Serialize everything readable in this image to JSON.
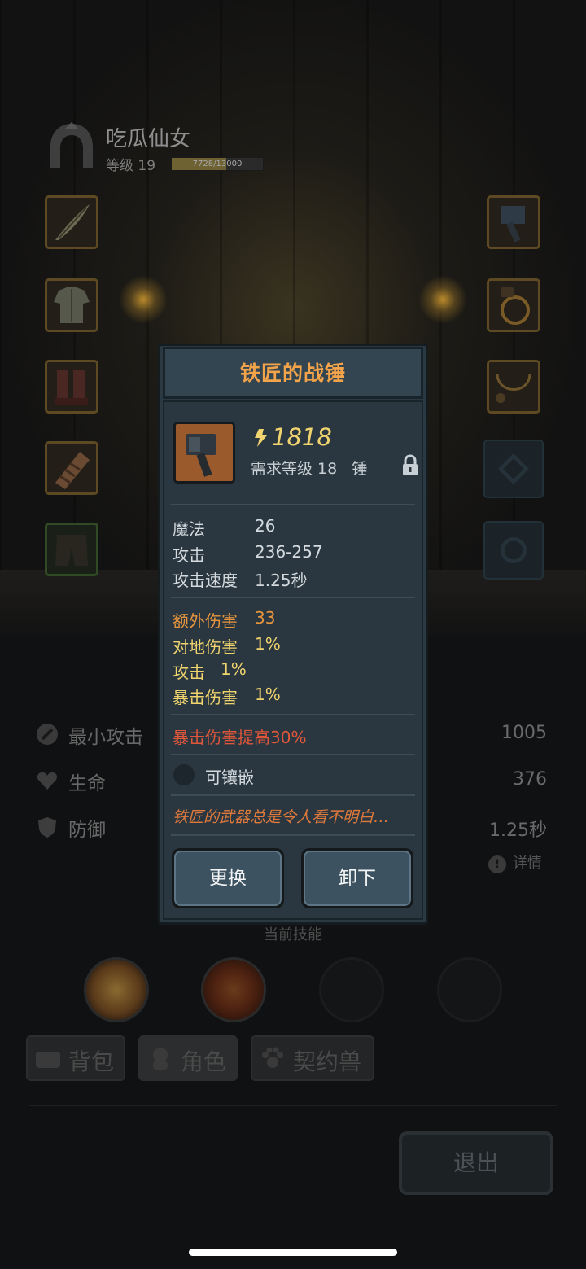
{
  "character": {
    "name": "吃瓜仙女",
    "level_label": "等级 19",
    "xp_text": "7728/13000",
    "xp_fraction": 0.594
  },
  "equipment_slots": {
    "left": [
      "feather-quill-icon",
      "cloth-armor-icon",
      "boots-icon",
      "bandage-glove-icon",
      "pants-icon"
    ],
    "right": [
      "hammer-weapon-icon",
      "ring-icon",
      "necklace-icon",
      "empty-slot",
      "empty-slot"
    ]
  },
  "stats": [
    {
      "label": "最小攻击",
      "value": "1005",
      "icon": "sword-icon"
    },
    {
      "label": "生命",
      "value": "376",
      "icon": "heart-icon"
    },
    {
      "label": "防御",
      "value": "1.25秒",
      "icon": "shield-icon"
    }
  ],
  "details_label": "详情",
  "skills_title": "当前技能",
  "tabs": [
    {
      "label": "背包",
      "icon": "bag-icon"
    },
    {
      "label": "角色",
      "icon": "character-icon"
    },
    {
      "label": "契约兽",
      "icon": "paw-icon"
    }
  ],
  "exit_label": "退出",
  "item": {
    "title": "铁匠的战锤",
    "power": "1818",
    "requirement": "需求等级 18   锤",
    "base_stats": [
      {
        "key": "魔法",
        "value": "26"
      },
      {
        "key": "攻击",
        "value": "236-257"
      },
      {
        "key": "攻击速度",
        "value": "1.25秒"
      }
    ],
    "bonus_stats": [
      {
        "key": "额外伤害",
        "value": "33"
      },
      {
        "key": "对地伤害",
        "value": "1%"
      },
      {
        "key": "攻击",
        "value": "1%"
      },
      {
        "key": "暴击伤害",
        "value": "1%"
      }
    ],
    "special": "暴击伤害提高30%",
    "socket": "可镶嵌",
    "flavor": "铁匠的武器总是令人看不明白…",
    "replace_label": "更换",
    "unequip_label": "卸下"
  },
  "colors": {
    "title": "#f3a34a",
    "power": "#f1d470",
    "bonus_orange": "#e8963e",
    "bonus_yellow": "#f0d46e",
    "special_red": "#e0573a",
    "panel": "#2a3740"
  }
}
